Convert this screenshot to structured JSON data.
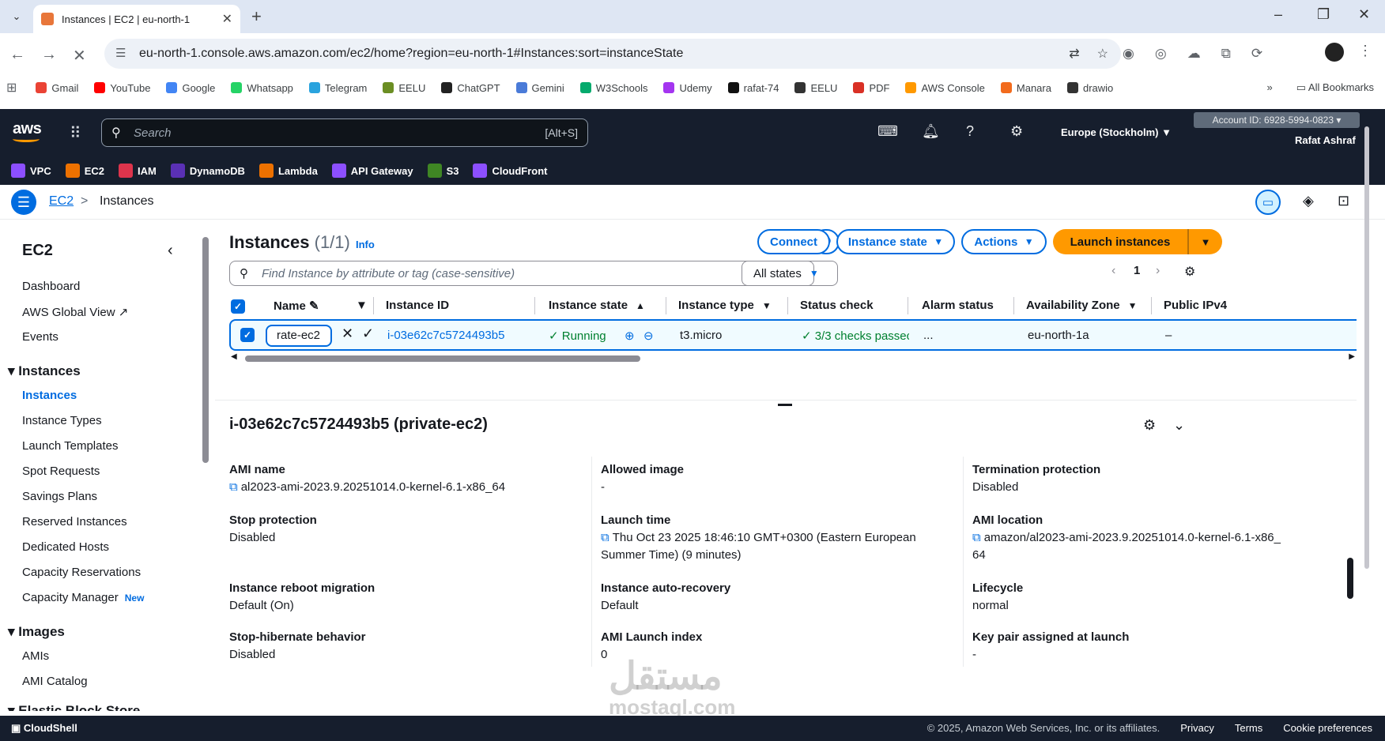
{
  "browser": {
    "tab_title": "Instances | EC2 | eu-north-1",
    "url": "eu-north-1.console.aws.amazon.com/ec2/home?region=eu-north-1#Instances:sort=instanceState",
    "bookmarks": [
      {
        "label": "Gmail",
        "color": "#ea4335"
      },
      {
        "label": "YouTube",
        "color": "#ff0000"
      },
      {
        "label": "Google",
        "color": "#4285f4"
      },
      {
        "label": "Whatsapp",
        "color": "#25d366"
      },
      {
        "label": "Telegram",
        "color": "#2aa3de"
      },
      {
        "label": "EELU",
        "color": "#6b8e23"
      },
      {
        "label": "ChatGPT",
        "color": "#222222"
      },
      {
        "label": "Gemini",
        "color": "#4a7bd8"
      },
      {
        "label": "W3Schools",
        "color": "#04aa6d"
      },
      {
        "label": "Udemy",
        "color": "#a435f0"
      },
      {
        "label": "rafat-74",
        "color": "#111111"
      },
      {
        "label": "EELU",
        "color": "#333333"
      },
      {
        "label": "PDF",
        "color": "#d93025"
      },
      {
        "label": "AWS Console",
        "color": "#ff9900"
      },
      {
        "label": "Manara",
        "color": "#f26b1d"
      },
      {
        "label": "drawio",
        "color": "#333333"
      }
    ],
    "more": "»",
    "all_bookmarks": "All Bookmarks"
  },
  "aws": {
    "search_placeholder": "Search",
    "search_shortcut": "[Alt+S]",
    "region": "Europe (Stockholm) ▼",
    "account": "Account ID: 6928-5994-0823 ▾",
    "user": "Rafat Ashraf",
    "favorites": [
      {
        "label": "VPC",
        "color": "#8c4fff"
      },
      {
        "label": "EC2",
        "color": "#ed7100"
      },
      {
        "label": "IAM",
        "color": "#dd344c"
      },
      {
        "label": "DynamoDB",
        "color": "#5a30b5"
      },
      {
        "label": "Lambda",
        "color": "#ed7100"
      },
      {
        "label": "API Gateway",
        "color": "#8c4fff"
      },
      {
        "label": "S3",
        "color": "#3f8624"
      },
      {
        "label": "CloudFront",
        "color": "#8c4fff"
      }
    ]
  },
  "breadcrumb": {
    "root": "EC2",
    "separator": ">",
    "current": "Instances"
  },
  "sidebar": {
    "title": "EC2",
    "top_items": [
      "Dashboard",
      "AWS Global View",
      "Events"
    ],
    "section_instances": "Instances",
    "instances_items": [
      "Instances",
      "Instance Types",
      "Launch Templates",
      "Spot Requests",
      "Savings Plans",
      "Reserved Instances",
      "Dedicated Hosts",
      "Capacity Reservations",
      "Capacity Manager"
    ],
    "new_badge": "New",
    "section_images": "Images",
    "images_items": [
      "AMIs",
      "AMI Catalog"
    ],
    "partial_section": "Elastic Block Store"
  },
  "instances": {
    "title": "Instances",
    "count": "(1/1)",
    "info": "Info",
    "connect": "Connect",
    "instance_state": "Instance state",
    "actions": "Actions",
    "launch": "Launch instances",
    "filter_placeholder": "Find Instance by attribute or tag (case-sensitive)",
    "states": "All states",
    "page": "1",
    "columns": [
      "Name",
      "Instance ID",
      "Instance state",
      "Instance type",
      "Status check",
      "Alarm status",
      "Availability Zone",
      "Public IPv4"
    ],
    "row": {
      "name": "rate-ec2",
      "id": "i-03e62c7c5724493b5",
      "state": "Running",
      "type": "t3.micro",
      "status": "3/3 checks passec",
      "alarm": "...",
      "az": "eu-north-1a",
      "ipv4": "–"
    }
  },
  "details": {
    "title": "i-03e62c7c5724493b5 (private-ec2)",
    "fields": {
      "ami_name_label": "AMI name",
      "ami_name_value": "al2023-ami-2023.9.20251014.0-kernel-6.1-x86_64",
      "allowed_image_label": "Allowed image",
      "allowed_image_value": "-",
      "termination_label": "Termination protection",
      "termination_value": "Disabled",
      "stop_protection_label": "Stop protection",
      "stop_protection_value": "Disabled",
      "launch_time_label": "Launch time",
      "launch_time_value1": "Thu Oct 23 2025 18:46:10 GMT+0300 (Eastern European",
      "launch_time_value2": "Summer Time) (9 minutes)",
      "ami_location_label": "AMI location",
      "ami_location_value1": "amazon/al2023-ami-2023.9.20251014.0-kernel-6.1-x86_",
      "ami_location_value2": "64",
      "reboot_label": "Instance reboot migration",
      "reboot_value": "Default (On)",
      "auto_recovery_label": "Instance auto-recovery",
      "auto_recovery_value": "Default",
      "lifecycle_label": "Lifecycle",
      "lifecycle_value": "normal",
      "hibernate_label": "Stop-hibernate behavior",
      "hibernate_value": "Disabled",
      "launch_index_label": "AMI Launch index",
      "launch_index_value": "0",
      "keypair_label": "Key pair assigned at launch",
      "keypair_value": "-"
    }
  },
  "footer": {
    "cloudshell": "CloudShell",
    "copyright": "© 2025, Amazon Web Services, Inc. or its affiliates.",
    "privacy": "Privacy",
    "terms": "Terms",
    "cookies": "Cookie preferences"
  },
  "watermark": {
    "arabic": "مستقل",
    "latin": "mostaql.com"
  }
}
